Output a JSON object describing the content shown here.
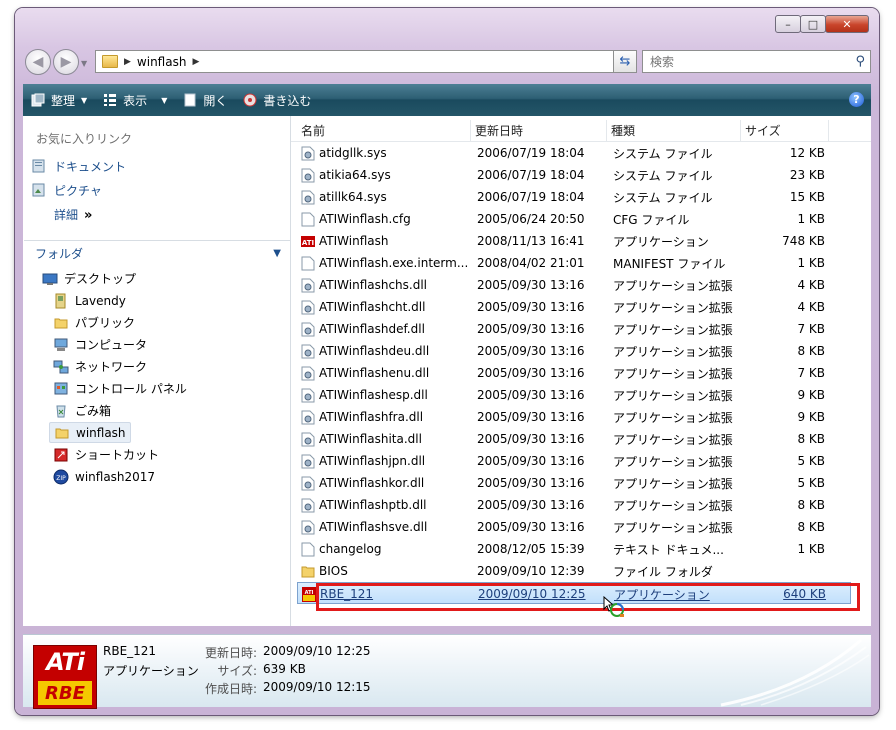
{
  "window": {
    "controls": {
      "minimize": "–",
      "maximize": "□",
      "close": "✕"
    }
  },
  "address": {
    "path": [
      "winflash"
    ]
  },
  "search": {
    "placeholder": "検索"
  },
  "toolbar": {
    "organize": "整理",
    "views": "表示",
    "open": "開く",
    "burn": "書き込む",
    "help": "?"
  },
  "nav": {
    "favorites_title": "お気に入りリンク",
    "favorites": [
      "ドキュメント",
      "ピクチャ"
    ],
    "details": "詳細",
    "details_chevron": "»",
    "folders_title": "フォルダ",
    "tree": [
      {
        "label": "デスクトップ",
        "icon": "desktop-icon"
      },
      {
        "label": "Lavendy",
        "icon": "user-folder-icon"
      },
      {
        "label": "パブリック",
        "icon": "folder-icon"
      },
      {
        "label": "コンピュータ",
        "icon": "computer-icon"
      },
      {
        "label": "ネットワーク",
        "icon": "network-icon"
      },
      {
        "label": "コントロール パネル",
        "icon": "control-panel-icon"
      },
      {
        "label": "ごみ箱",
        "icon": "recycle-bin-icon"
      },
      {
        "label": "winflash",
        "icon": "folder-icon"
      },
      {
        "label": "ショートカット",
        "icon": "shortcut-icon"
      },
      {
        "label": "winflash2017",
        "icon": "zip-icon"
      }
    ]
  },
  "columns": {
    "name": "名前",
    "date": "更新日時",
    "type": "種類",
    "size": "サイズ"
  },
  "files": [
    {
      "name": "atidgllk.sys",
      "date": "2006/07/19 18:04",
      "type": "システム ファイル",
      "size": "12 KB",
      "icon": "sys"
    },
    {
      "name": "atikia64.sys",
      "date": "2006/07/19 18:04",
      "type": "システム ファイル",
      "size": "23 KB",
      "icon": "sys"
    },
    {
      "name": "atillk64.sys",
      "date": "2006/07/19 18:04",
      "type": "システム ファイル",
      "size": "15 KB",
      "icon": "sys"
    },
    {
      "name": "ATIWinflash.cfg",
      "date": "2005/06/24 20:50",
      "type": "CFG ファイル",
      "size": "1 KB",
      "icon": "blank"
    },
    {
      "name": "ATIWinflash",
      "date": "2008/11/13 16:41",
      "type": "アプリケーション",
      "size": "748 KB",
      "icon": "ati"
    },
    {
      "name": "ATIWinflash.exe.interm...",
      "date": "2008/04/02 21:01",
      "type": "MANIFEST ファイル",
      "size": "1 KB",
      "icon": "blank"
    },
    {
      "name": "ATIWinflashchs.dll",
      "date": "2005/09/30 13:16",
      "type": "アプリケーション拡張",
      "size": "4 KB",
      "icon": "sys"
    },
    {
      "name": "ATIWinflashcht.dll",
      "date": "2005/09/30 13:16",
      "type": "アプリケーション拡張",
      "size": "4 KB",
      "icon": "sys"
    },
    {
      "name": "ATIWinflashdef.dll",
      "date": "2005/09/30 13:16",
      "type": "アプリケーション拡張",
      "size": "7 KB",
      "icon": "sys"
    },
    {
      "name": "ATIWinflashdeu.dll",
      "date": "2005/09/30 13:16",
      "type": "アプリケーション拡張",
      "size": "8 KB",
      "icon": "sys"
    },
    {
      "name": "ATIWinflashenu.dll",
      "date": "2005/09/30 13:16",
      "type": "アプリケーション拡張",
      "size": "7 KB",
      "icon": "sys"
    },
    {
      "name": "ATIWinflashesp.dll",
      "date": "2005/09/30 13:16",
      "type": "アプリケーション拡張",
      "size": "9 KB",
      "icon": "sys"
    },
    {
      "name": "ATIWinflashfra.dll",
      "date": "2005/09/30 13:16",
      "type": "アプリケーション拡張",
      "size": "9 KB",
      "icon": "sys"
    },
    {
      "name": "ATIWinflashita.dll",
      "date": "2005/09/30 13:16",
      "type": "アプリケーション拡張",
      "size": "8 KB",
      "icon": "sys"
    },
    {
      "name": "ATIWinflashjpn.dll",
      "date": "2005/09/30 13:16",
      "type": "アプリケーション拡張",
      "size": "5 KB",
      "icon": "sys"
    },
    {
      "name": "ATIWinflashkor.dll",
      "date": "2005/09/30 13:16",
      "type": "アプリケーション拡張",
      "size": "5 KB",
      "icon": "sys"
    },
    {
      "name": "ATIWinflashptb.dll",
      "date": "2005/09/30 13:16",
      "type": "アプリケーション拡張",
      "size": "8 KB",
      "icon": "sys"
    },
    {
      "name": "ATIWinflashsve.dll",
      "date": "2005/09/30 13:16",
      "type": "アプリケーション拡張",
      "size": "8 KB",
      "icon": "sys"
    },
    {
      "name": "changelog",
      "date": "2008/12/05 15:39",
      "type": "テキスト ドキュメ...",
      "size": "1 KB",
      "icon": "blank"
    },
    {
      "name": "BIOS",
      "date": "2009/09/10 12:39",
      "type": "ファイル フォルダ",
      "size": "",
      "icon": "folder"
    },
    {
      "name": "RBE_121",
      "date": "2009/09/10 12:25",
      "type": "アプリケーション",
      "size": "640 KB",
      "icon": "rbe",
      "highlighted": true
    }
  ],
  "details_pane": {
    "logo_top": "ATi",
    "logo_bottom": "RBE",
    "name": "RBE_121",
    "kind": "アプリケーション",
    "modified_label": "更新日時:",
    "modified_value": "2009/09/10 12:25",
    "size_label": "サイズ:",
    "size_value": "639 KB",
    "created_label": "作成日時:",
    "created_value": "2009/09/10 12:15"
  }
}
